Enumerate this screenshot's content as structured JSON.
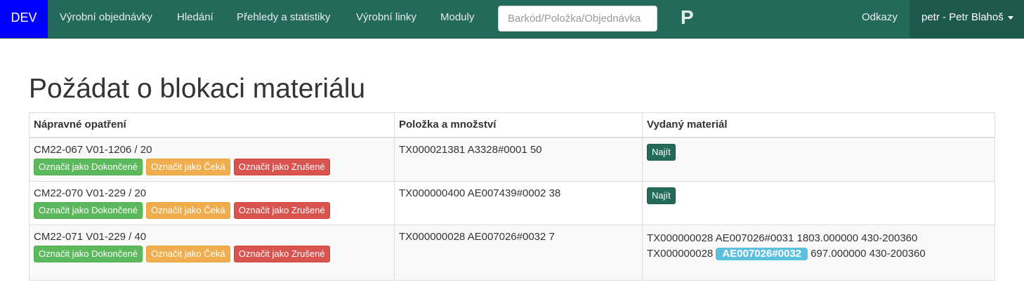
{
  "navbar": {
    "env": "DEV",
    "links": [
      "Výrobní objednávky",
      "Hledání",
      "Přehledy a statistiky",
      "Výrobní linky",
      "Moduly"
    ],
    "search_placeholder": "Barkód/Položka/Objednávka",
    "brand": "P",
    "right_link": "Odkazy",
    "user": "petr - Petr Blahoš"
  },
  "page": {
    "title": "Požádat o blokaci materiálu"
  },
  "table": {
    "headers": [
      "Nápravné opatření",
      "Položka a množství",
      "Vydaný materiál"
    ],
    "rows": [
      {
        "ref": "CM22-067 V01-1206 / 20",
        "item": "TX000021381 A3328#0001 50",
        "find_label": "Najít"
      },
      {
        "ref": "CM22-070 V01-229 / 20",
        "item": "TX000000400 AE007439#0002 38",
        "find_label": "Najít"
      },
      {
        "ref": "CM22-071 V01-229 / 40",
        "item": "TX000000028 AE007026#0032 7",
        "materials": [
          {
            "text": "TX000000028 AE007026#0031 1803.000000 430-200360"
          },
          {
            "prefix": "TX000000028",
            "badge": "AE007026#0032",
            "suffix": "697.000000 430-200360"
          }
        ]
      }
    ],
    "actions": {
      "done": "Označit jako Dokončené",
      "wait": "Označit jako Čeká",
      "cancel": "Označit jako Zrušené"
    }
  }
}
